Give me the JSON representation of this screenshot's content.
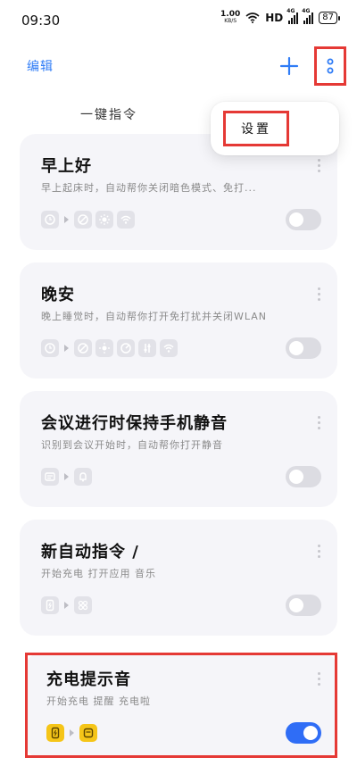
{
  "status": {
    "time": "09:30",
    "speed_value": "1.00",
    "speed_unit": "KB/S",
    "hd": "HD",
    "net1": "4G",
    "net2": "4G",
    "battery": "87"
  },
  "header": {
    "edit_label": "编辑",
    "section_title": "一键指令"
  },
  "popup": {
    "settings_label": "设置"
  },
  "cards": [
    {
      "title": "早上好",
      "description": "早上起床时，自动帮你关闭暗色模式、免打...",
      "enabled": false,
      "icons": [
        "clock-icon",
        "dnd-icon",
        "sun-icon",
        "wifi-icon"
      ]
    },
    {
      "title": "晚安",
      "description": "晚上睡觉时，自动帮你打开免打扰并关闭WLAN",
      "enabled": false,
      "icons": [
        "clock-icon",
        "dnd-icon",
        "sun-icon",
        "gauge-icon",
        "sliders-icon",
        "wifi-icon"
      ]
    },
    {
      "title": "会议进行时保持手机静音",
      "description": "识别到会议开始时，自动帮你打开静音",
      "enabled": false,
      "icons": [
        "calendar-icon",
        "bell-icon"
      ]
    },
    {
      "title": "新自动指令 /",
      "description": "开始充电 打开应用 音乐",
      "enabled": false,
      "icons": [
        "phone-charge-icon",
        "apps-icon"
      ]
    },
    {
      "title": "充电提示音",
      "description": "开始充电 提醒 充电啦",
      "enabled": true,
      "icons": [
        "phone-charge-icon",
        "note-icon"
      ]
    }
  ],
  "colors": {
    "accent": "#2f6df6",
    "highlight_box": "#e53935",
    "card_bg": "#f5f5f9",
    "icon_active": "#f5c518"
  }
}
